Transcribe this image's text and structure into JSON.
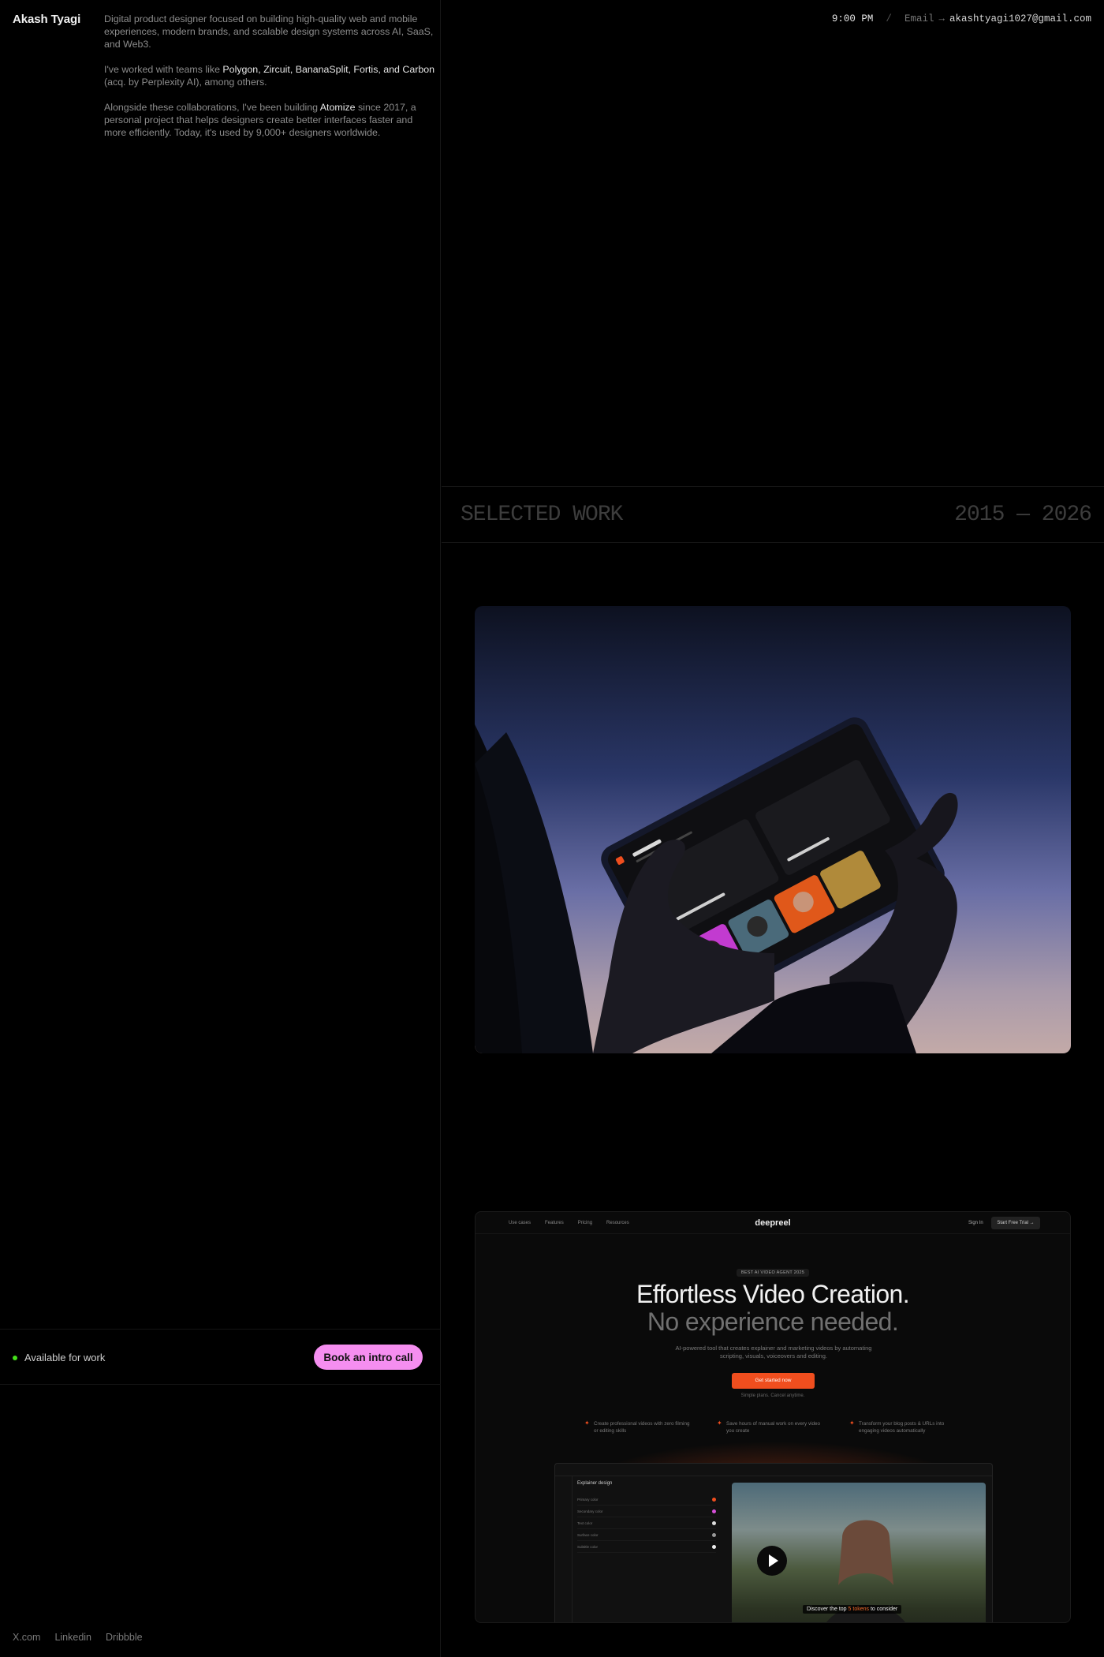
{
  "profile": {
    "name": "Akash Tyagi",
    "bio_p1": "Digital product designer focused on building high-quality web and mobile experiences, modern brands, and scalable design systems across AI, SaaS, and Web3.",
    "bio_p2_pre": "I've worked with teams like ",
    "bio_p2_teams": "Polygon, Zircuit, BananaSplit, Fortis, and Carbon",
    "bio_p2_post": " (acq. by Perplexity AI), among others.",
    "bio_p3_pre": "Alongside these collaborations, I've been building ",
    "bio_p3_project": "Atomize",
    "bio_p3_post": " since 2017, a personal project that helps designers create better interfaces faster and more efficiently. Today, it's used by 9,000+ designers worldwide."
  },
  "header": {
    "time": "9:00 PM",
    "separator": "/",
    "email_label": "Email",
    "arrow": "→",
    "email": "akashtyagi1027@gmail.com"
  },
  "availability": {
    "status": "Available for work",
    "cta": "Book an intro call",
    "status_color": "#45e01a",
    "cta_color": "#f58ef0"
  },
  "social": [
    "X.com",
    "Linkedin",
    "Dribbble"
  ],
  "work": {
    "title": "SELECTED WORK",
    "years": "2015 — 2026"
  },
  "deepreel": {
    "nav_links": [
      "Use cases",
      "Features",
      "Pricing",
      "Resources"
    ],
    "logo": "deepreel",
    "sign_in": "Sign In",
    "trial": "Start Free Trial →",
    "badge": "BEST AI VIDEO AGENT 2025",
    "headline": "Effortless Video Creation.",
    "headline2": "No experience needed.",
    "subtext": "AI-powered tool that creates explainer and marketing videos by automating scripting, visuals, voiceovers and editing.",
    "cta": "Get started now",
    "note": "Simple plans. Cancel anytime.",
    "features": [
      "Create professional videos with zero filming or editing skills",
      "Save hours of manual work on every video you create",
      "Transform your blog posts & URLs into engaging videos automatically"
    ],
    "panel_title": "Explainer design",
    "panel_rows": [
      "Primary color",
      "Secondary color",
      "Text color",
      "Surface color",
      "Subtitle color"
    ],
    "caption_pre": "Discover the top ",
    "caption_hl": "5 tokens",
    "caption_post": " to consider",
    "accent": "#f04e1e"
  }
}
